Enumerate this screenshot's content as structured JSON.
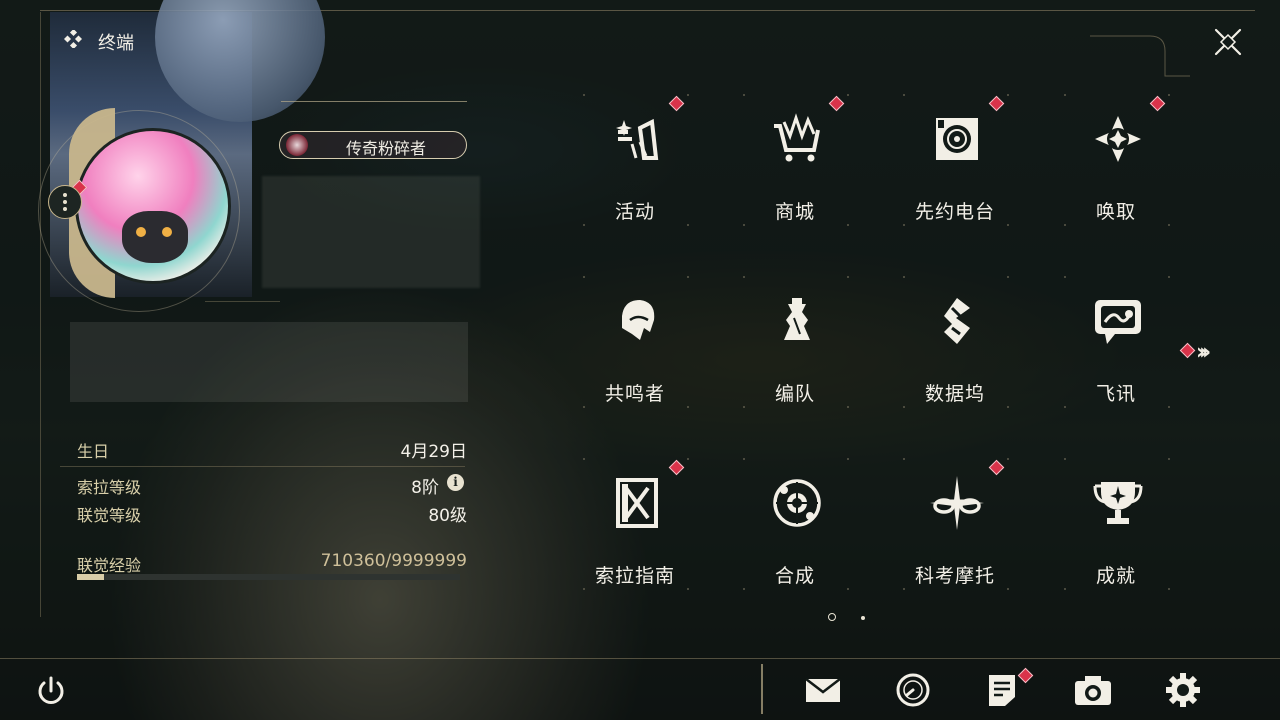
{
  "header": {
    "title": "终端"
  },
  "profile": {
    "title_badge": "传奇粉碎者",
    "stats": [
      {
        "label": "生日",
        "value": "4月29日"
      },
      {
        "label": "索拉等级",
        "value": "8阶"
      },
      {
        "label": "联觉等级",
        "value": "80级"
      },
      {
        "label": "联觉经验",
        "value": "710360/9999999"
      }
    ],
    "exp_progress": 0.071
  },
  "menu": {
    "items": [
      {
        "label": "活动",
        "icon": "activity-icon",
        "badge": true
      },
      {
        "label": "商城",
        "icon": "shop-cart-icon",
        "badge": true
      },
      {
        "label": "先约电台",
        "icon": "radio-icon",
        "badge": true
      },
      {
        "label": "唤取",
        "icon": "convene-icon",
        "badge": true
      },
      {
        "label": "共鸣者",
        "icon": "resonator-icon",
        "badge": false
      },
      {
        "label": "编队",
        "icon": "chess-team-icon",
        "badge": false
      },
      {
        "label": "数据坞",
        "icon": "data-bank-icon",
        "badge": false
      },
      {
        "label": "飞讯",
        "icon": "chat-icon",
        "badge": false
      },
      {
        "label": "索拉指南",
        "icon": "guidebook-icon",
        "badge": true
      },
      {
        "label": "合成",
        "icon": "synthesis-icon",
        "badge": false
      },
      {
        "label": "科考摩托",
        "icon": "motorcycle-icon",
        "badge": true
      },
      {
        "label": "成就",
        "icon": "trophy-icon",
        "badge": false
      }
    ],
    "current_page": 1,
    "total_pages": 2
  },
  "bottom_bar": {
    "buttons": [
      "mail-icon",
      "clock-icon",
      "notes-icon",
      "camera-icon",
      "settings-gear-icon"
    ],
    "power": "power-icon"
  },
  "colors": {
    "accent_gold": "#c8b68c",
    "badge_red": "#d9334a",
    "text": "#f2efe7"
  }
}
